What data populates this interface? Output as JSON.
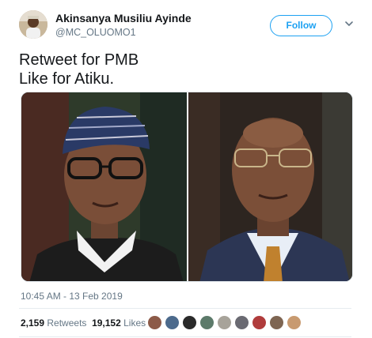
{
  "author": {
    "display_name": "Akinsanya Musiliu Ayinde",
    "handle": "@MC_OLUOMO1"
  },
  "actions": {
    "follow_label": "Follow"
  },
  "tweet": {
    "line1": "Retweet for PMB",
    "line2": "Like for Atiku."
  },
  "timestamp": "10:45 AM - 13 Feb 2019",
  "stats": {
    "retweets_count": "2,159",
    "retweets_label": "Retweets",
    "likes_count": "19,152",
    "likes_label": "Likes"
  },
  "colors": {
    "accent": "#1da1f2",
    "secondary_text": "#657786",
    "primary_text": "#14171a"
  },
  "icons": {
    "more_menu": "chevron-down-icon"
  }
}
